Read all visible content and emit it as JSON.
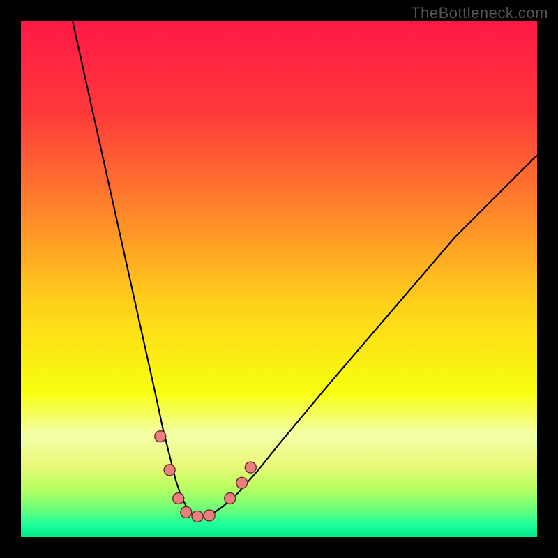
{
  "watermark": "TheBottleneck.com",
  "chart_data": {
    "type": "line",
    "title": "",
    "xlabel": "",
    "ylabel": "",
    "xlim": [
      0,
      100
    ],
    "ylim": [
      0,
      100
    ],
    "background_gradient_stops": [
      {
        "offset": 0,
        "color": "#ff1846"
      },
      {
        "offset": 0.18,
        "color": "#ff3a3a"
      },
      {
        "offset": 0.38,
        "color": "#ff8a2a"
      },
      {
        "offset": 0.55,
        "color": "#ffd21a"
      },
      {
        "offset": 0.72,
        "color": "#f8ff10"
      },
      {
        "offset": 0.8,
        "color": "#f3ffa8"
      },
      {
        "offset": 0.86,
        "color": "#ebf87a"
      },
      {
        "offset": 0.905,
        "color": "#b8ff60"
      },
      {
        "offset": 0.945,
        "color": "#6eff7a"
      },
      {
        "offset": 0.975,
        "color": "#1fff9a"
      },
      {
        "offset": 1.0,
        "color": "#00e884"
      }
    ],
    "series": [
      {
        "name": "curve",
        "x": [
          10,
          12,
          14,
          16,
          18,
          20,
          22,
          24,
          26,
          27.5,
          29,
          30,
          31,
          32,
          33,
          34,
          35.5,
          37,
          39,
          42,
          46,
          50,
          55,
          60,
          66,
          72,
          78,
          84,
          90,
          96,
          100
        ],
        "y": [
          100,
          91,
          82,
          73,
          64,
          55,
          46,
          37,
          28,
          21,
          15,
          11,
          8,
          6,
          4.5,
          4,
          4,
          4.5,
          5.8,
          8.5,
          13,
          18,
          24,
          30,
          37,
          44,
          51,
          58,
          64,
          70,
          74
        ]
      }
    ],
    "markers": {
      "fill": "#e98080",
      "stroke": "#6b2a2a",
      "points": [
        {
          "x": 27.0,
          "y": 19.5,
          "r": 8
        },
        {
          "x": 28.8,
          "y": 13.0,
          "r": 8
        },
        {
          "x": 30.5,
          "y": 7.5,
          "r": 8
        },
        {
          "x": 32.0,
          "y": 4.8,
          "r": 8
        },
        {
          "x": 34.2,
          "y": 4.0,
          "r": 8
        },
        {
          "x": 36.5,
          "y": 4.2,
          "r": 8
        },
        {
          "x": 40.5,
          "y": 7.5,
          "r": 8
        },
        {
          "x": 42.8,
          "y": 10.5,
          "r": 8
        },
        {
          "x": 44.5,
          "y": 13.5,
          "r": 8
        }
      ]
    }
  }
}
